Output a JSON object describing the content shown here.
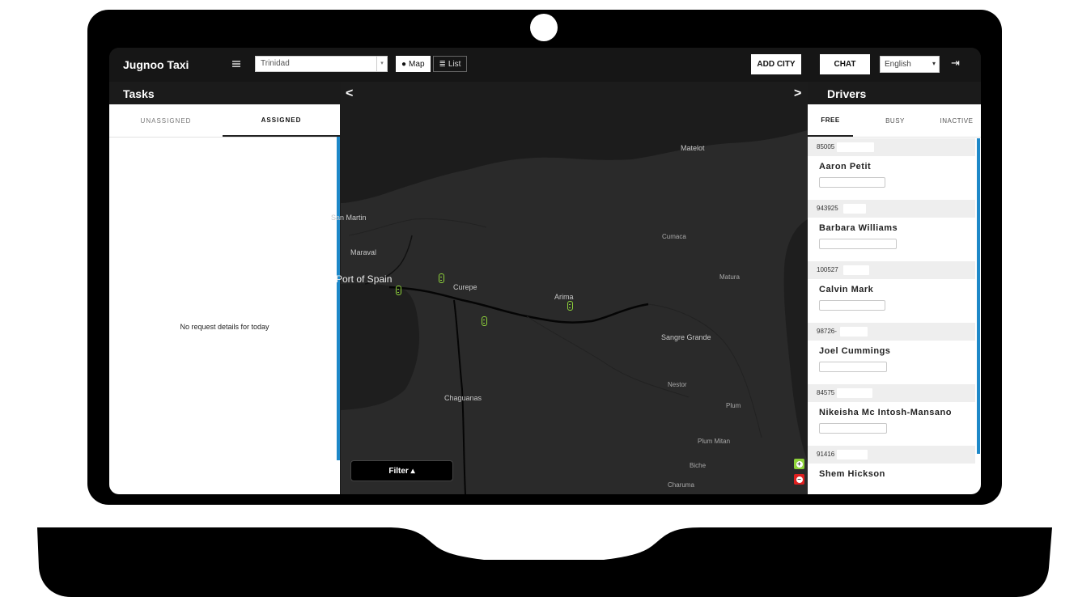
{
  "app": {
    "brand": "Jugnoo Taxi",
    "city": "Trinidad",
    "view_map": "Map",
    "view_list": "List",
    "add_city": "ADD CITY",
    "chat": "CHAT",
    "language": "English"
  },
  "tasks": {
    "title": "Tasks",
    "tabs": [
      "UNASSIGNED",
      "ASSIGNED"
    ],
    "active_tab": "ASSIGNED",
    "empty_message": "No request details for today"
  },
  "map": {
    "nav_prev": "<",
    "nav_next": ">",
    "filter_label": "Filter ▴",
    "labels": {
      "matelot": "Matelot",
      "san_martin": "San Martin",
      "maraval": "Maraval",
      "cumaca": "Cumaca",
      "port_of_spain": "Port of Spain",
      "curepe": "Curepe",
      "arima": "Arima",
      "matura": "Matura",
      "sangre_grande": "Sangre Grande",
      "nestor": "Nestor",
      "plum": "Plum",
      "chaguanas": "Chaguanas",
      "plum_mitan": "Plum Mitan",
      "biche": "Biche",
      "charuma": "Charuma"
    },
    "car_count": 5
  },
  "drivers": {
    "title": "Drivers",
    "tabs": [
      "FREE",
      "BUSY",
      "INACTIVE"
    ],
    "active_tab": "FREE",
    "list": [
      {
        "id": "85005",
        "name": "Aaron Petit"
      },
      {
        "id": "943925",
        "name": "Barbara Williams"
      },
      {
        "id": "100527",
        "name": "Calvin Mark"
      },
      {
        "id": "98726-",
        "name": "Joel Cummings"
      },
      {
        "id": "84575",
        "name": "Nikeisha Mc Intosh-Mansano"
      },
      {
        "id": "91416",
        "name": "Shem Hickson"
      }
    ]
  },
  "colors": {
    "accent_blue": "#1e88c8",
    "car_green": "#8ed23a",
    "zoom_out_red": "#e02020",
    "map_bg": "#1b1b1b"
  }
}
